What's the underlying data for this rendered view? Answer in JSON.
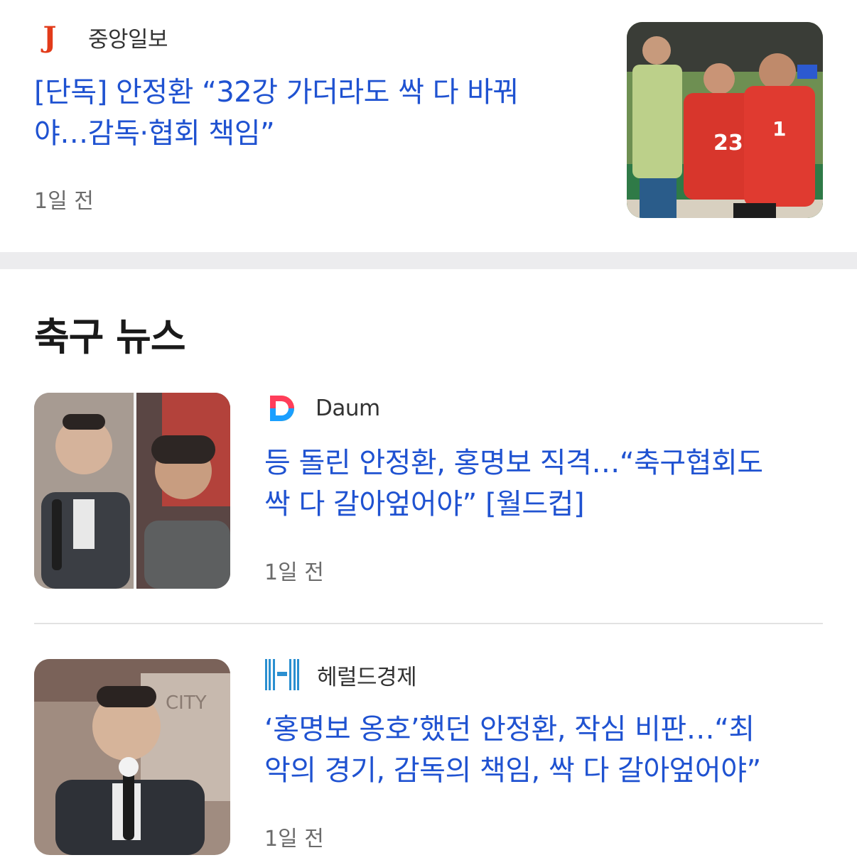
{
  "articles": [
    {
      "source": "중앙일보",
      "logo_icon": "joongang-logo-icon",
      "title_line1": "[단독] 안정환 “32강 가더라도 싹 다 바꿔",
      "title_line2": "야…감독·협회 책임”",
      "time": "1일 전"
    },
    {
      "source": "Daum",
      "logo_icon": "daum-logo-icon",
      "title_line1": "등 돌린 안정환, 홍명보 직격…“축구협회도",
      "title_line2": "싹 다 갈아엎어야” [월드컵]",
      "time": "1일 전"
    },
    {
      "source": "헤럴드경제",
      "logo_icon": "herald-logo-icon",
      "title_line1": "‘홍명보 옹호’했던 안정환, 작심 비판…“최",
      "title_line2": "악의 경기, 감독의 책임, 싹 다 갈아엎어야”",
      "time": "1일 전"
    }
  ],
  "section": {
    "title": "축구 뉴스"
  },
  "colors": {
    "headline": "#1f52d1",
    "divider_band": "#ececee",
    "joongang_red": "#e23b1a"
  }
}
